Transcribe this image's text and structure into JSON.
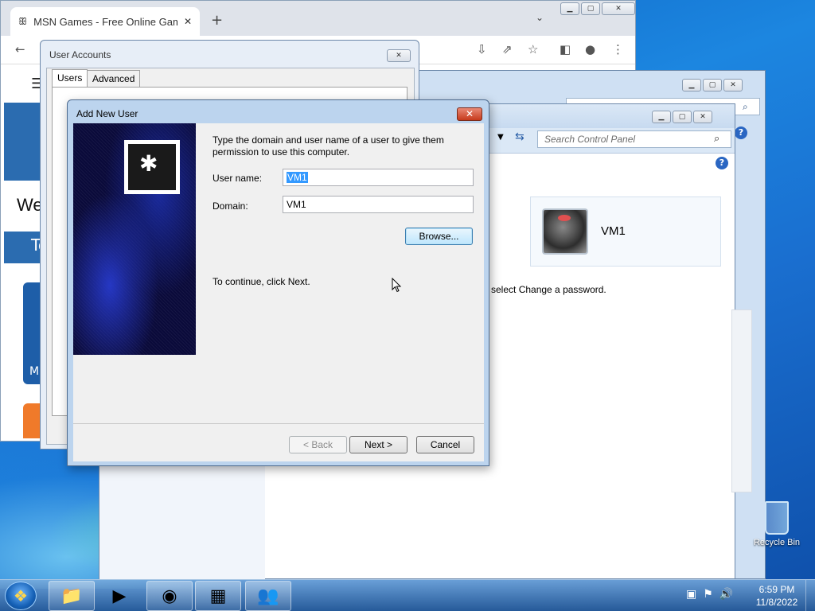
{
  "browser": {
    "tab_title": "MSN Games - Free Online Games",
    "new_tab": "+",
    "tab_close": "✕",
    "partial_heading": "We",
    "partial_banner": "To",
    "partial_card": "M"
  },
  "control_panel": {
    "search_placeholder": "Search Control Panel",
    "account_name": "VM1",
    "change_text": "d select Change a password.",
    "help": "?"
  },
  "user_accounts": {
    "title": "User Accounts",
    "tabs": [
      "Users",
      "Advanced"
    ]
  },
  "add_user": {
    "title": "Add New User",
    "instructions": "Type the domain and user name of a user to give them permission to use this computer.",
    "username_label": "User name:",
    "username_value": "VM1",
    "domain_label": "Domain:",
    "domain_value": "VM1",
    "browse_label": "Browse...",
    "continue_text": "To continue, click Next.",
    "back_label": "< Back",
    "next_label": "Next >",
    "cancel_label": "Cancel",
    "close": "✕"
  },
  "desktop": {
    "recycle_bin": "Recycle Bin"
  },
  "taskbar": {
    "time": "6:59 PM",
    "date": "11/8/2022",
    "items": [
      "file-explorer",
      "media-player",
      "chrome",
      "control-panel",
      "user-accounts"
    ]
  },
  "colors": {
    "selection": "#3399ff",
    "close_button": "#c63a1c",
    "desktop": "#1a6fd0"
  }
}
